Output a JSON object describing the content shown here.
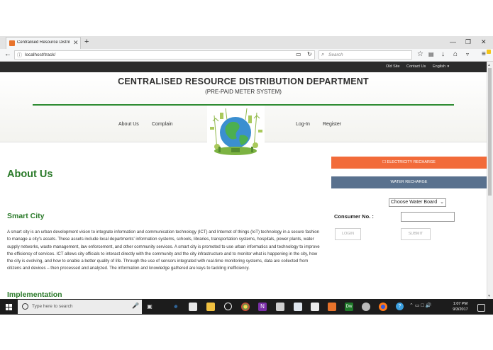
{
  "browser": {
    "tab_title": "Centralised Resource Distrib",
    "tab_close": "✕",
    "new_tab": "+",
    "win_min": "—",
    "win_max": "❐",
    "win_close": "✕",
    "url": "localhost/track/",
    "search_placeholder": "Search",
    "icons": [
      "back-icon",
      "info-icon",
      "reader-icon",
      "reload-icon",
      "search-icon",
      "star-icon",
      "clipboard-icon",
      "download-icon",
      "home-icon",
      "pocket-icon",
      "menu-icon"
    ]
  },
  "top_links": {
    "old_site": "Old Site",
    "contact": "Contact Us",
    "language": "English"
  },
  "header": {
    "title": "CENTRALISED RESOURCE DISTRIBUTION DEPARTMENT",
    "subtitle": "(PRE-PAID METER SYSTEM)"
  },
  "menu": {
    "about": "About Us",
    "complain": "Complain",
    "login": "Log-In",
    "register": "Register"
  },
  "content": {
    "about_heading": "About Us",
    "smart_heading": "Smart City",
    "smart_text": "A smart city is an urban development vision to integrate information and communication technology (ICT) and Internet of things (IoT) technology in a secure fashion to manage a city's assets. These assets include local departments' information systems, schools, libraries, transportation systems, hospitals, power plants, water supply networks, waste management, law enforcement, and other community services. A smart city is promoted to use urban informatics and technology to improve the efficiency of services. ICT allows city officials to interact directly with the community and the city infrastructure and to monitor what is happening in the city, how the city is evolving, and how to enable a better quality of life. Through the use of sensors integrated with real-time monitoring systems, data are collected from citizens and devices – then processed and analyzed. The information and knowledge gathered are keys to tackling inefficiency.",
    "implementation_heading": "Implementation"
  },
  "sidebar": {
    "electricity_button": "ELECTRICITY RECHARGE",
    "water_button": "WATER RECHARGE",
    "water_board_select": "Choose Water Board",
    "consumer_label": "Consumer No. :",
    "consumer_value": "",
    "login_button": "LOGIN",
    "submit_button": "SUBMIT"
  },
  "taskbar": {
    "search_placeholder": "Type here to search",
    "time": "1:07 PM",
    "date": "9/3/2017"
  },
  "colors": {
    "brand_green": "#2a7a29",
    "electricity": "#f26b3a",
    "water": "#59718e",
    "top_strip": "#2b2b2b"
  }
}
